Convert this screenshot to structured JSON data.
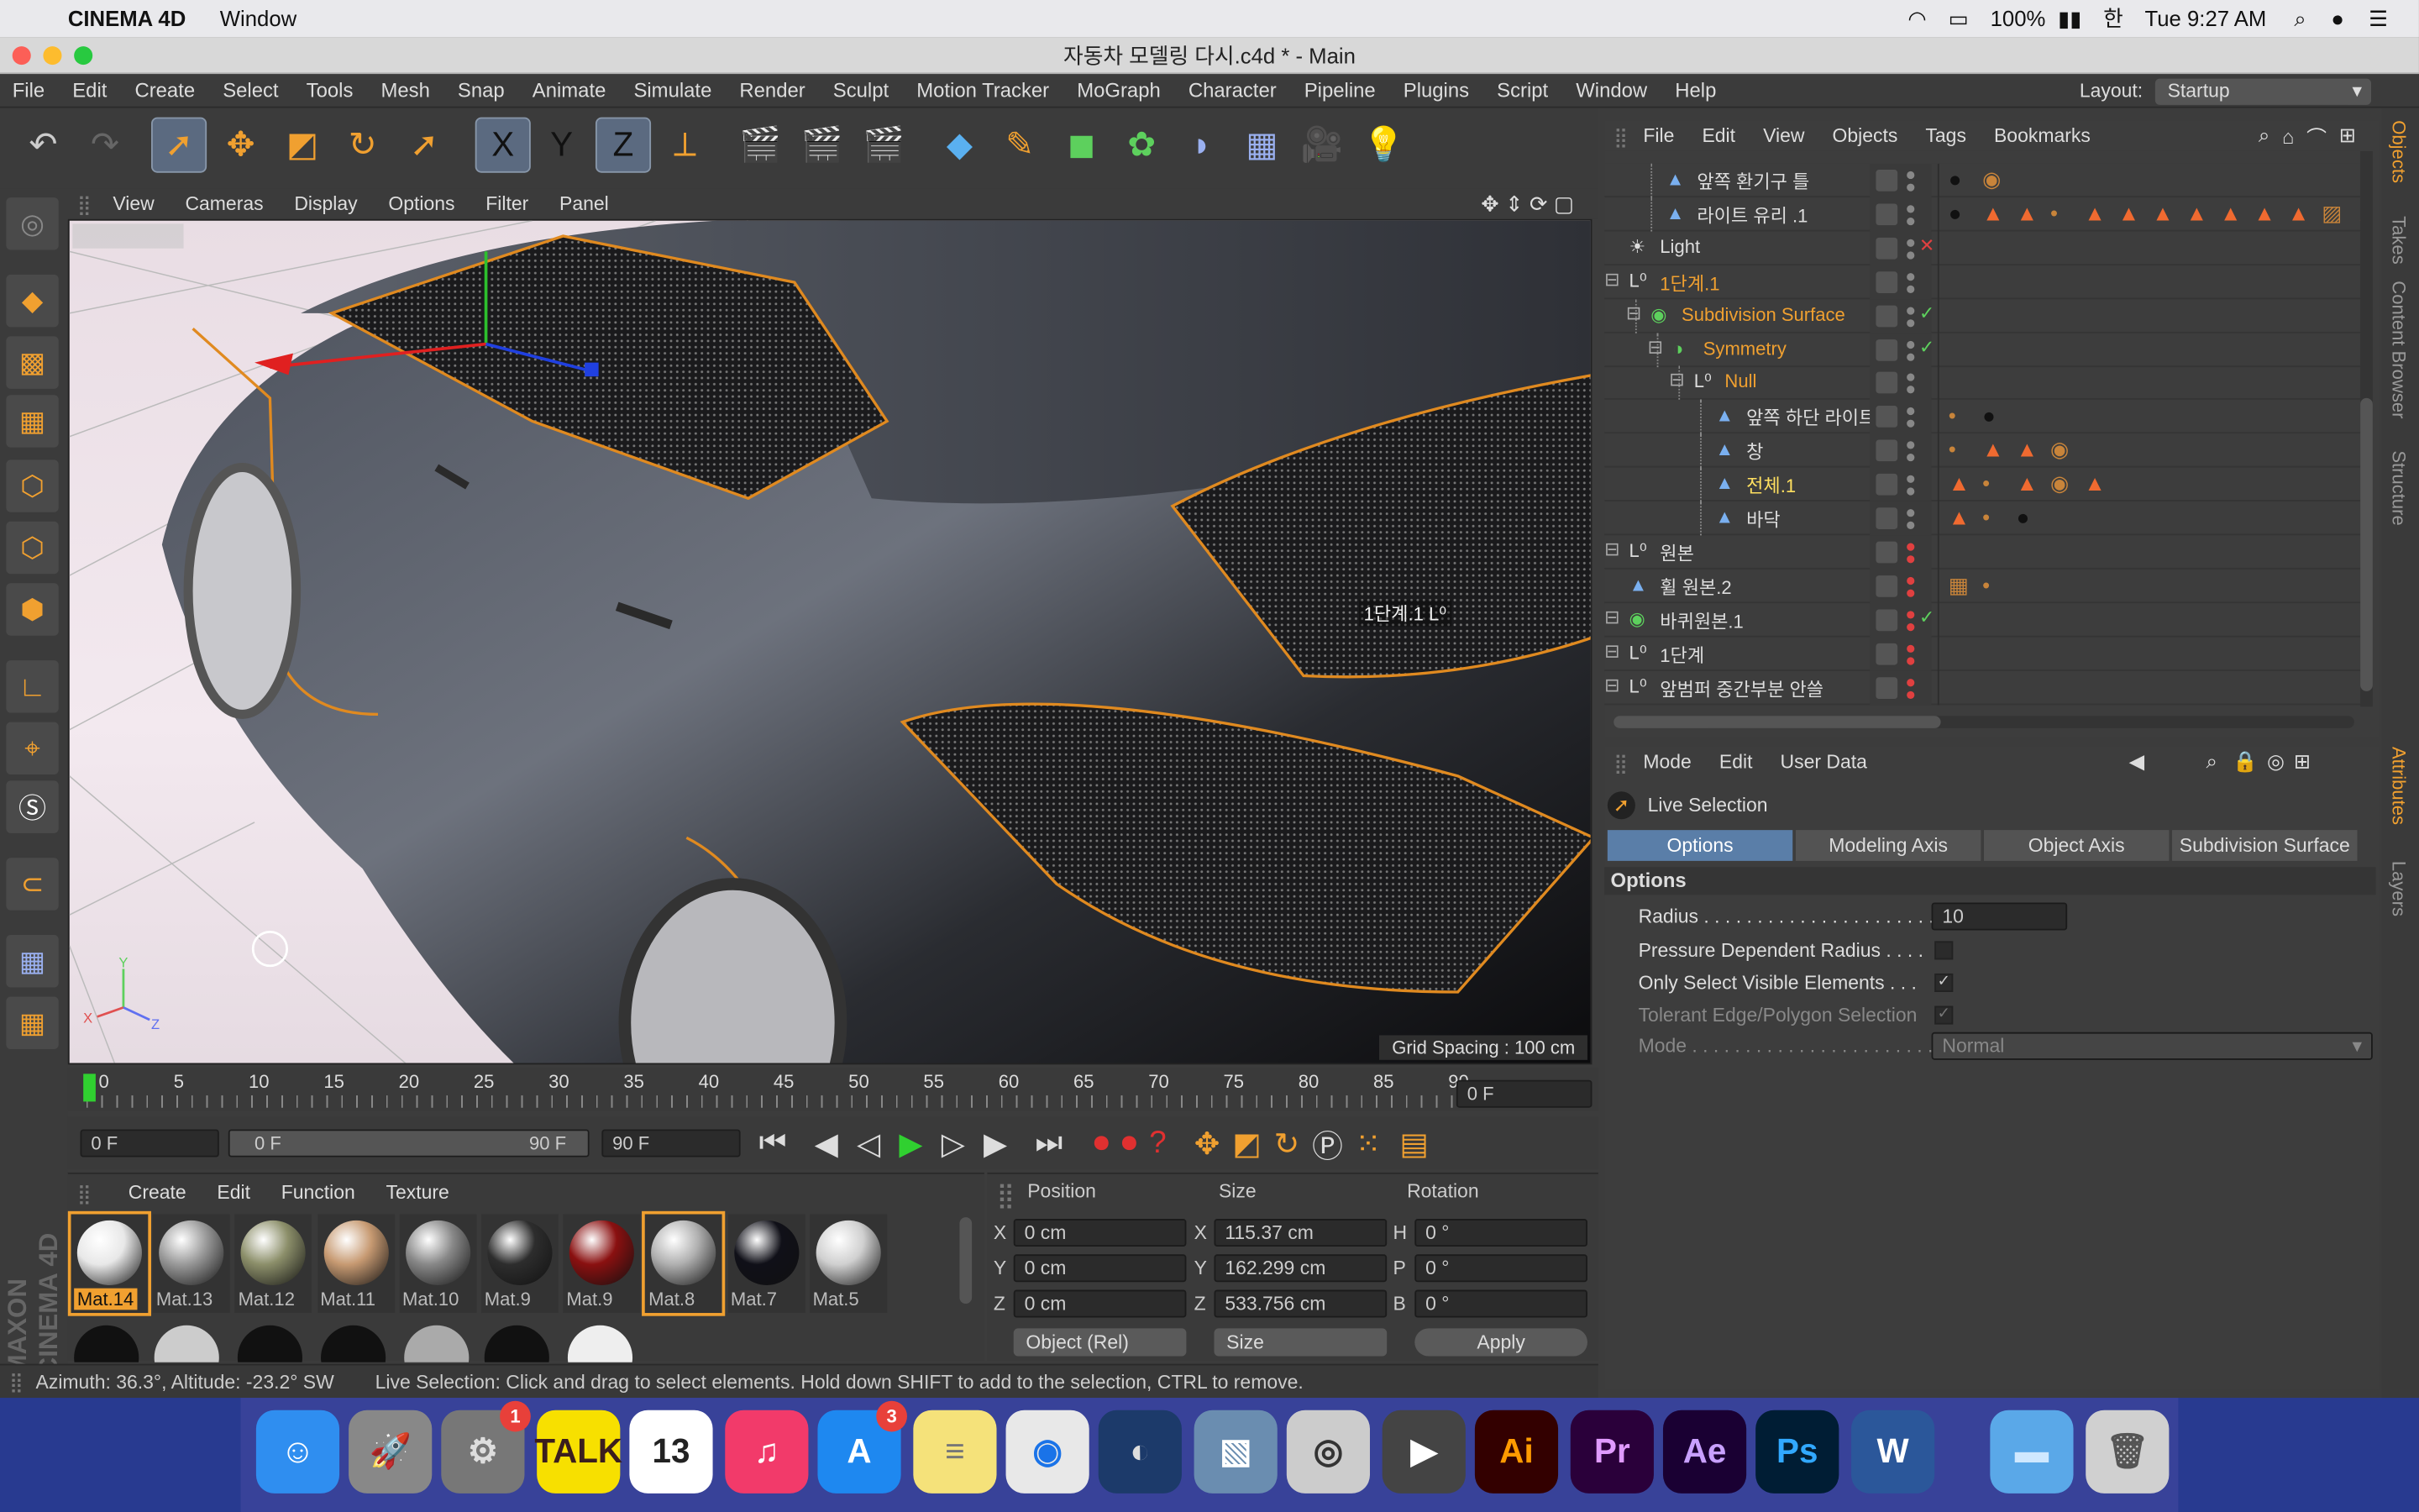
{
  "mac_menubar": {
    "app": "CINEMA 4D",
    "window": "Window",
    "battery": "100%",
    "clock": "Tue 9:27 AM"
  },
  "title": "자동차 모델링 다시.c4d * - Main",
  "app_menu": [
    "File",
    "Edit",
    "Create",
    "Select",
    "Tools",
    "Mesh",
    "Snap",
    "Animate",
    "Simulate",
    "Render",
    "Sculpt",
    "Motion Tracker",
    "MoGraph",
    "Character",
    "Pipeline",
    "Plugins",
    "Script",
    "Window",
    "Help"
  ],
  "layout": {
    "label": "Layout:",
    "value": "Startup"
  },
  "toolbar_icons": [
    "undo-icon",
    "redo-icon",
    "live-selection-icon",
    "move-icon",
    "scale-icon",
    "rotate-icon",
    "recent-tool-icon",
    "x-axis-icon",
    "y-axis-icon",
    "z-axis-icon",
    "coordinate-system-icon",
    "render-view-icon",
    "render-picture-viewer-icon",
    "render-settings-icon",
    "cube-icon",
    "pen-icon",
    "subdivision-icon",
    "array-icon",
    "deformer-icon",
    "floor-icon",
    "camera-icon",
    "light-icon"
  ],
  "axis_labels": {
    "x": "X",
    "y": "Y",
    "z": "Z"
  },
  "viewport": {
    "menu": [
      "View",
      "Cameras",
      "Display",
      "Options",
      "Filter",
      "Panel"
    ],
    "grid_spacing": "Grid Spacing : 100 cm",
    "object_label": "1단계.1"
  },
  "timeline": {
    "ticks": [
      "0",
      "5",
      "10",
      "15",
      "20",
      "25",
      "30",
      "35",
      "40",
      "45",
      "50",
      "55",
      "60",
      "65",
      "70",
      "75",
      "80",
      "85",
      "90"
    ],
    "current_frame": "0 F"
  },
  "playback": {
    "start": "0 F",
    "range_start": "0 F",
    "range_end": "90 F",
    "end": "90 F"
  },
  "materials": {
    "menu": [
      "Create",
      "Edit",
      "Function",
      "Texture"
    ],
    "items": [
      {
        "name": "Mat.14",
        "color": "#e8e8e8"
      },
      {
        "name": "Mat.13",
        "color": "#9a9a9a"
      },
      {
        "name": "Mat.12",
        "color": "#8c8f6a"
      },
      {
        "name": "Mat.11",
        "color": "#c79a72"
      },
      {
        "name": "Mat.10",
        "color": "#888888"
      },
      {
        "name": "Mat.9",
        "color": "#2d2d2d"
      },
      {
        "name": "Mat.9",
        "color": "#8a1010"
      },
      {
        "name": "Mat.8",
        "color": "#b0b0b0"
      },
      {
        "name": "Mat.7",
        "color": "#101018"
      },
      {
        "name": "Mat.5",
        "color": "#d0d0d0"
      }
    ]
  },
  "coordinates": {
    "headers": [
      "Position",
      "Size",
      "Rotation"
    ],
    "rows": [
      {
        "axis": "X",
        "pos": "0 cm",
        "saxis": "X",
        "size": "115.37 cm",
        "raxis": "H",
        "rot": "0 °"
      },
      {
        "axis": "Y",
        "pos": "0 cm",
        "saxis": "Y",
        "size": "162.299 cm",
        "raxis": "P",
        "rot": "0 °"
      },
      {
        "axis": "Z",
        "pos": "0 cm",
        "saxis": "Z",
        "size": "533.756 cm",
        "raxis": "B",
        "rot": "0 °"
      }
    ],
    "mode": "Object (Rel)",
    "size_mode": "Size",
    "apply": "Apply"
  },
  "status": {
    "left": "Azimuth: 36.3°, Altitude: -23.2°  SW",
    "message": "Live Selection: Click and drag to select elements. Hold down SHIFT to add to the selection, CTRL to remove."
  },
  "object_manager": {
    "menu": [
      "File",
      "Edit",
      "View",
      "Objects",
      "Tags",
      "Bookmarks"
    ],
    "rows": [
      {
        "name": "앞쪽 환기구 틀",
        "indent": 40,
        "type": "poly",
        "color": "#ddd"
      },
      {
        "name": "라이트 유리 .1",
        "indent": 40,
        "type": "poly",
        "color": "#ddd"
      },
      {
        "name": "Light",
        "indent": 16,
        "type": "light",
        "color": "#ddd"
      },
      {
        "name": "1단계.1",
        "indent": 16,
        "type": "null",
        "color": "#f0a030"
      },
      {
        "name": "Subdivision Surface",
        "indent": 30,
        "type": "sds",
        "color": "#f0a030"
      },
      {
        "name": "Symmetry",
        "indent": 44,
        "type": "sym",
        "color": "#f0a030"
      },
      {
        "name": "Null",
        "indent": 58,
        "type": "null",
        "color": "#f0a030"
      },
      {
        "name": "앞쪽 하단 라이트",
        "indent": 72,
        "type": "poly",
        "color": "#ddd"
      },
      {
        "name": "창",
        "indent": 72,
        "type": "poly",
        "color": "#ddd"
      },
      {
        "name": "전체.1",
        "indent": 72,
        "type": "poly",
        "color": "#ffe060"
      },
      {
        "name": "바닥",
        "indent": 72,
        "type": "poly",
        "color": "#ddd"
      },
      {
        "name": "원본",
        "indent": 16,
        "type": "null",
        "color": "#ddd"
      },
      {
        "name": "휠 원본.2",
        "indent": 16,
        "type": "poly",
        "color": "#ddd"
      },
      {
        "name": "바퀴원본.1",
        "indent": 16,
        "type": "sds",
        "color": "#ddd"
      },
      {
        "name": "1단계",
        "indent": 16,
        "type": "null",
        "color": "#ddd"
      },
      {
        "name": "앞범퍼 중간부분 안쓸",
        "indent": 16,
        "type": "null",
        "color": "#ddd"
      }
    ]
  },
  "attributes": {
    "menu": [
      "Mode",
      "Edit",
      "User Data"
    ],
    "tool": "Live Selection",
    "tabs": [
      "Options",
      "Modeling Axis",
      "Object Axis",
      "Subdivision Surface"
    ],
    "section": "Options",
    "props": [
      {
        "label": "Radius . . . . . . . . . . . . . . . . . . . . . . .",
        "value": "10"
      },
      {
        "label": "Pressure Dependent Radius . . . .",
        "value": ""
      },
      {
        "label": "Only Select Visible Elements . . .",
        "value": "✓"
      },
      {
        "label": "Tolerant Edge/Polygon Selection",
        "value": "✓"
      },
      {
        "label": "Mode . . . . . . . . . . . . . . . . . . . . . . . . .",
        "value": "Normal"
      }
    ]
  },
  "side_tabs": [
    "Objects",
    "Takes",
    "Content Browser",
    "Structure",
    "Attributes",
    "Layers"
  ],
  "brand": "MAXON CINEMA 4D",
  "dock": [
    {
      "name": "finder-icon",
      "label": "☺",
      "bg": "#2f8ef0",
      "fg": "#fff",
      "badge": ""
    },
    {
      "name": "launchpad-icon",
      "label": "🚀",
      "bg": "#888",
      "fg": "#fff",
      "badge": ""
    },
    {
      "name": "system-preferences-icon",
      "label": "⚙",
      "bg": "#777",
      "fg": "#ddd",
      "badge": "1"
    },
    {
      "name": "kakaotalk-icon",
      "label": "TALK",
      "bg": "#f7e000",
      "fg": "#3b1e1e",
      "badge": ""
    },
    {
      "name": "calendar-icon",
      "label": "13",
      "bg": "#fff",
      "fg": "#222",
      "badge": ""
    },
    {
      "name": "itunes-icon",
      "label": "♫",
      "bg": "#f23a6a",
      "fg": "#fff",
      "badge": ""
    },
    {
      "name": "app-store-icon",
      "label": "A",
      "bg": "#1e88f0",
      "fg": "#fff",
      "badge": "3"
    },
    {
      "name": "notes-icon",
      "label": "≡",
      "bg": "#f5e27a",
      "fg": "#777",
      "badge": ""
    },
    {
      "name": "chrome-icon",
      "label": "◉",
      "bg": "#e8e8e8",
      "fg": "#1a73e8",
      "badge": ""
    },
    {
      "name": "cinema4d-icon",
      "label": "◐",
      "bg": "#1c3a6a",
      "fg": "#ddd",
      "badge": ""
    },
    {
      "name": "preview-icon",
      "label": "▧",
      "bg": "#6a8db0",
      "fg": "#fff",
      "badge": ""
    },
    {
      "name": "disk-utility-icon",
      "label": "◎",
      "bg": "#ccc",
      "fg": "#333",
      "badge": ""
    },
    {
      "name": "final-cut-icon",
      "label": "▶",
      "bg": "#444",
      "fg": "#fff",
      "badge": ""
    },
    {
      "name": "illustrator-icon",
      "label": "Ai",
      "bg": "#330000",
      "fg": "#ff9a00",
      "badge": ""
    },
    {
      "name": "premiere-icon",
      "label": "Pr",
      "bg": "#2a003a",
      "fg": "#e09aff",
      "badge": ""
    },
    {
      "name": "after-effects-icon",
      "label": "Ae",
      "bg": "#1a0033",
      "fg": "#c8a0ff",
      "badge": ""
    },
    {
      "name": "photoshop-icon",
      "label": "Ps",
      "bg": "#001d34",
      "fg": "#31a8ff",
      "badge": ""
    },
    {
      "name": "word-icon",
      "label": "W",
      "bg": "#2b579a",
      "fg": "#fff",
      "badge": ""
    },
    {
      "name": "folder-icon",
      "label": "▬",
      "bg": "#5aa8e8",
      "fg": "#cfe8ff",
      "badge": ""
    },
    {
      "name": "trash-icon",
      "label": "🗑",
      "bg": "#d0d0d0",
      "fg": "#555",
      "badge": ""
    }
  ]
}
